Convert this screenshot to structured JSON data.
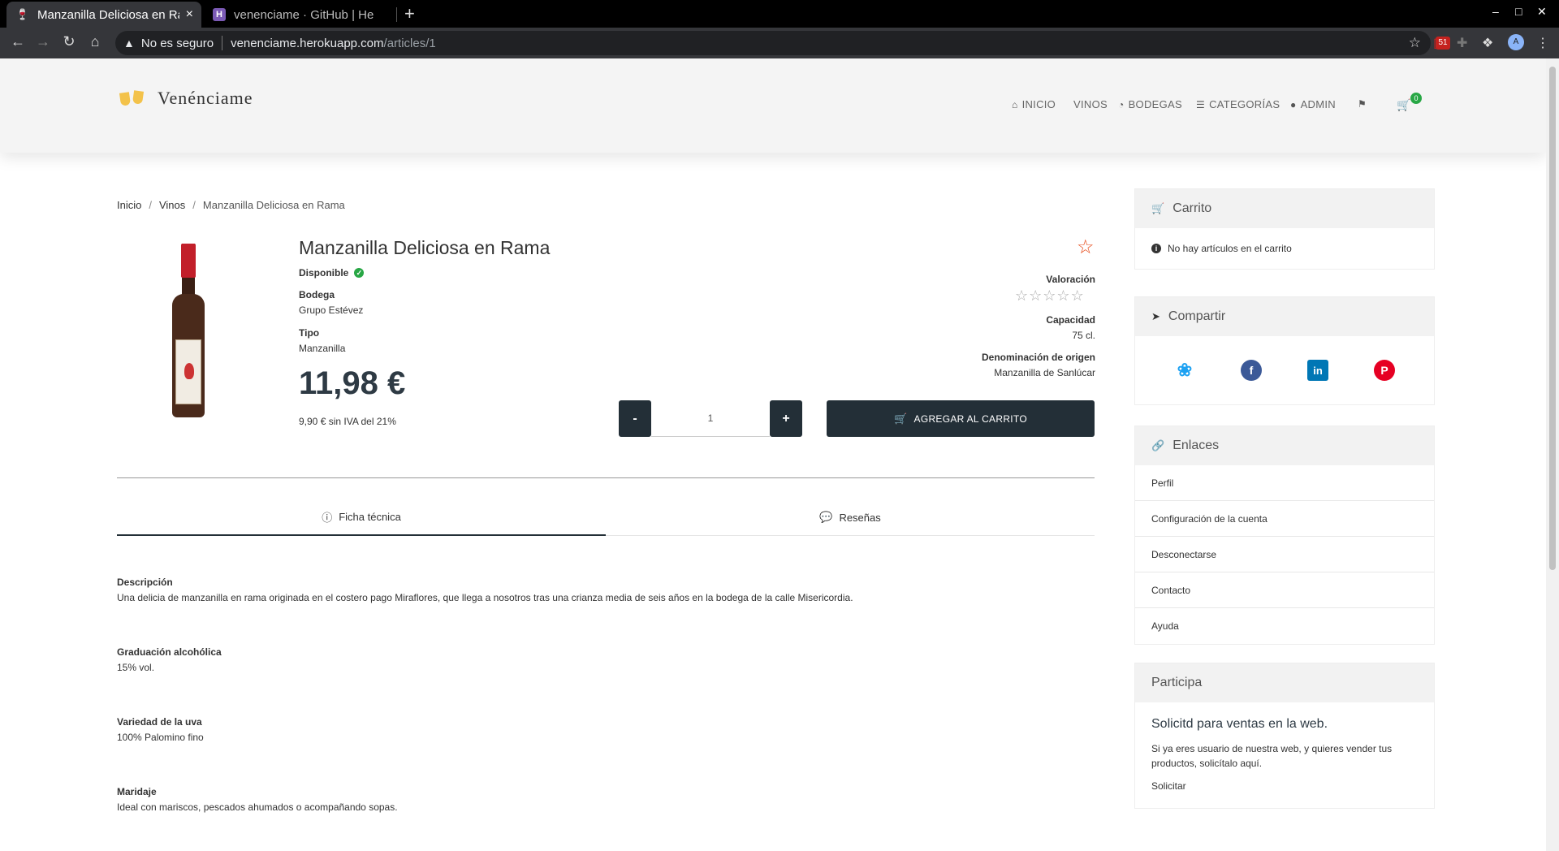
{
  "browser": {
    "tabs": [
      {
        "title": "Manzanilla Deliciosa en Ra",
        "active": true,
        "icon": "wine-glass-icon"
      },
      {
        "title": "venenciame · GitHub | He",
        "active": false,
        "icon": "heroku-icon"
      }
    ],
    "security_label": "No es seguro",
    "url_host": "venenciame.herokuapp.com",
    "url_path": "/articles/1",
    "extension_badge": "51",
    "profile_initial": "A"
  },
  "header": {
    "brand": "Venénciame",
    "nav": [
      {
        "label": "INICIO",
        "icon": "home-icon"
      },
      {
        "label": "VINOS",
        "icon": ""
      },
      {
        "label": "BODEGAS",
        "icon": "barrel-icon"
      },
      {
        "label": "CATEGORÍAS",
        "icon": "list-icon"
      },
      {
        "label": "ADMIN",
        "icon": "user-icon"
      }
    ],
    "cart_count": "0"
  },
  "breadcrumb": {
    "items": [
      "Inicio",
      "Vinos"
    ],
    "current": "Manzanilla Deliciosa en Rama"
  },
  "product": {
    "title": "Manzanilla Deliciosa en Rama",
    "availability": "Disponible",
    "winery_label": "Bodega",
    "winery": "Grupo Estévez",
    "type_label": "Tipo",
    "type": "Manzanilla",
    "price": "11,98 €",
    "price_without_tax": "9,90 € sin IVA del 21%",
    "rating_label": "Valoración",
    "rating": 0,
    "rating_max": 5,
    "capacity_label": "Capacidad",
    "capacity": "75 cl.",
    "origin_label": "Denominación de origen",
    "origin": "Manzanilla de Sanlúcar",
    "quantity": "1",
    "minus": "-",
    "plus": "+",
    "add_to_cart": "AGREGAR AL CARRITO"
  },
  "tabs": {
    "specs": "Ficha técnica",
    "reviews": "Reseñas"
  },
  "specs": {
    "description_label": "Descripción",
    "description": "Una delicia de manzanilla en rama originada en el costero pago Miraflores, que llega a nosotros tras una crianza media de seis años en la bodega de la calle Misericordia.",
    "alcohol_label": "Graduación alcohólica",
    "alcohol": "15% vol.",
    "grape_label": "Variedad de la uva",
    "grape": "100% Palomino fino",
    "pairing_label": "Maridaje",
    "pairing": "Ideal con mariscos, pescados ahumados o acompañando sopas."
  },
  "sidebar": {
    "cart_title": "Carrito",
    "cart_empty": "No hay artículos en el carrito",
    "share_title": "Compartir",
    "share_networks": [
      "twitter",
      "facebook",
      "linkedin",
      "pinterest"
    ],
    "links_title": "Enlaces",
    "links": [
      "Perfil",
      "Configuración de la cuenta",
      "Desconectarse",
      "Contacto",
      "Ayuda"
    ],
    "participa_title": "Participa",
    "participa_heading": "Solicitd para ventas en la web.",
    "participa_text": "Si ya eres usuario de nuestra web, y quieres vender tus productos, solicítalo aquí.",
    "participa_link": "Solicitar"
  },
  "colors": {
    "primary_dark": "#232f37",
    "accent_star": "#e64a19",
    "available": "#28a745",
    "twitter": "#1da1f2",
    "facebook": "#3b5998",
    "linkedin": "#0077b5",
    "pinterest": "#e60023"
  }
}
